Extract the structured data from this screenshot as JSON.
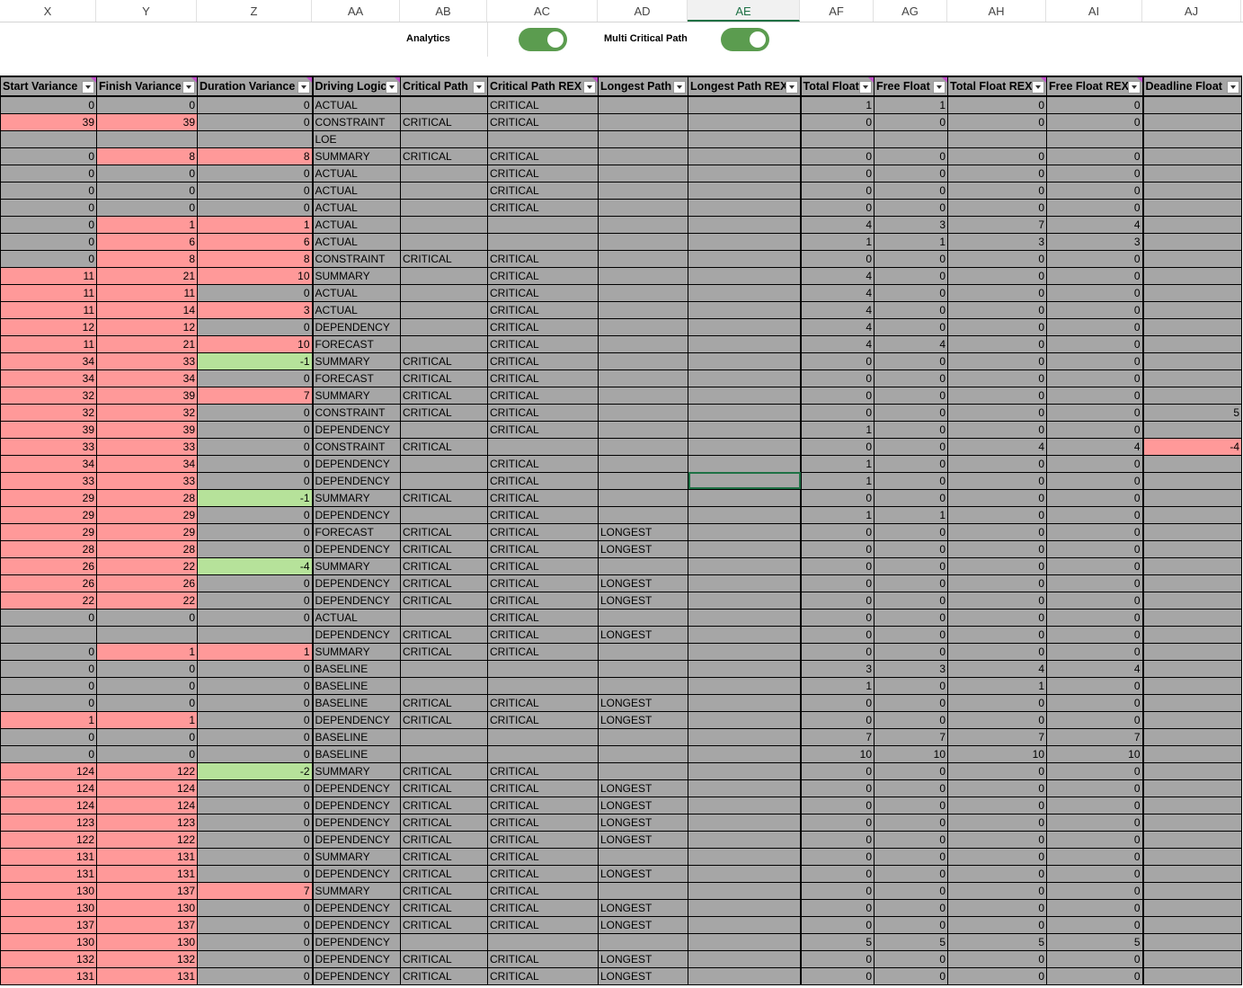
{
  "column_letters": [
    "X",
    "Y",
    "Z",
    "AA",
    "AB",
    "AC",
    "AD",
    "AE",
    "AF",
    "AG",
    "AH",
    "AI",
    "AJ"
  ],
  "selected_column": "AE",
  "toggles": [
    {
      "label": "Analytics",
      "on": true
    },
    {
      "label": "Multi Critical Path",
      "on": true
    }
  ],
  "colors": {
    "red": "#ff9999",
    "green": "#b6e29a",
    "gray": "#a6a6a6",
    "toggle": "#5b9c4f",
    "selection": "#1e7145"
  },
  "headers": [
    "Start Variance",
    "Finish Variance",
    "Duration Variance",
    "Driving Logic",
    "Critical Path",
    "Critical Path REX",
    "Longest Path",
    "Longest Path REX",
    "Total Float",
    "Free Float",
    "Total Float REX",
    "Free Float REX",
    "Deadline Float"
  ],
  "rows": [
    [
      "0",
      "0",
      "0",
      "ACTUAL",
      "",
      "CRITICAL",
      "",
      "",
      "1",
      "1",
      "0",
      "0",
      ""
    ],
    [
      "39",
      "39",
      "0",
      "CONSTRAINT",
      "CRITICAL",
      "CRITICAL",
      "",
      "",
      "0",
      "0",
      "0",
      "0",
      ""
    ],
    [
      "",
      "",
      "",
      "LOE",
      "",
      "",
      "",
      "",
      "",
      "",
      "",
      "",
      ""
    ],
    [
      "0",
      "8",
      "8",
      "SUMMARY",
      "CRITICAL",
      "CRITICAL",
      "",
      "",
      "0",
      "0",
      "0",
      "0",
      ""
    ],
    [
      "0",
      "0",
      "0",
      "ACTUAL",
      "",
      "CRITICAL",
      "",
      "",
      "0",
      "0",
      "0",
      "0",
      ""
    ],
    [
      "0",
      "0",
      "0",
      "ACTUAL",
      "",
      "CRITICAL",
      "",
      "",
      "0",
      "0",
      "0",
      "0",
      ""
    ],
    [
      "0",
      "0",
      "0",
      "ACTUAL",
      "",
      "CRITICAL",
      "",
      "",
      "0",
      "0",
      "0",
      "0",
      ""
    ],
    [
      "0",
      "1",
      "1",
      "ACTUAL",
      "",
      "",
      "",
      "",
      "4",
      "3",
      "7",
      "4",
      ""
    ],
    [
      "0",
      "6",
      "6",
      "ACTUAL",
      "",
      "",
      "",
      "",
      "1",
      "1",
      "3",
      "3",
      ""
    ],
    [
      "0",
      "8",
      "8",
      "CONSTRAINT",
      "CRITICAL",
      "CRITICAL",
      "",
      "",
      "0",
      "0",
      "0",
      "0",
      ""
    ],
    [
      "11",
      "21",
      "10",
      "SUMMARY",
      "",
      "CRITICAL",
      "",
      "",
      "4",
      "0",
      "0",
      "0",
      ""
    ],
    [
      "11",
      "11",
      "0",
      "ACTUAL",
      "",
      "CRITICAL",
      "",
      "",
      "4",
      "0",
      "0",
      "0",
      ""
    ],
    [
      "11",
      "14",
      "3",
      "ACTUAL",
      "",
      "CRITICAL",
      "",
      "",
      "4",
      "0",
      "0",
      "0",
      ""
    ],
    [
      "12",
      "12",
      "0",
      "DEPENDENCY",
      "",
      "CRITICAL",
      "",
      "",
      "4",
      "0",
      "0",
      "0",
      ""
    ],
    [
      "11",
      "21",
      "10",
      "FORECAST",
      "",
      "CRITICAL",
      "",
      "",
      "4",
      "4",
      "0",
      "0",
      ""
    ],
    [
      "34",
      "33",
      "-1",
      "SUMMARY",
      "CRITICAL",
      "CRITICAL",
      "",
      "",
      "0",
      "0",
      "0",
      "0",
      ""
    ],
    [
      "34",
      "34",
      "0",
      "FORECAST",
      "CRITICAL",
      "CRITICAL",
      "",
      "",
      "0",
      "0",
      "0",
      "0",
      ""
    ],
    [
      "32",
      "39",
      "7",
      "SUMMARY",
      "CRITICAL",
      "CRITICAL",
      "",
      "",
      "0",
      "0",
      "0",
      "0",
      ""
    ],
    [
      "32",
      "32",
      "0",
      "CONSTRAINT",
      "CRITICAL",
      "CRITICAL",
      "",
      "",
      "0",
      "0",
      "0",
      "0",
      "5"
    ],
    [
      "39",
      "39",
      "0",
      "DEPENDENCY",
      "",
      "CRITICAL",
      "",
      "",
      "1",
      "0",
      "0",
      "0",
      ""
    ],
    [
      "33",
      "33",
      "0",
      "CONSTRAINT",
      "CRITICAL",
      "",
      "",
      "",
      "0",
      "0",
      "4",
      "4",
      "-4"
    ],
    [
      "34",
      "34",
      "0",
      "DEPENDENCY",
      "",
      "CRITICAL",
      "",
      "",
      "1",
      "0",
      "0",
      "0",
      ""
    ],
    [
      "33",
      "33",
      "0",
      "DEPENDENCY",
      "",
      "CRITICAL",
      "",
      "",
      "1",
      "0",
      "0",
      "0",
      ""
    ],
    [
      "29",
      "28",
      "-1",
      "SUMMARY",
      "CRITICAL",
      "CRITICAL",
      "",
      "",
      "0",
      "0",
      "0",
      "0",
      ""
    ],
    [
      "29",
      "29",
      "0",
      "DEPENDENCY",
      "",
      "CRITICAL",
      "",
      "",
      "1",
      "1",
      "0",
      "0",
      ""
    ],
    [
      "29",
      "29",
      "0",
      "FORECAST",
      "CRITICAL",
      "CRITICAL",
      "LONGEST",
      "",
      "0",
      "0",
      "0",
      "0",
      ""
    ],
    [
      "28",
      "28",
      "0",
      "DEPENDENCY",
      "CRITICAL",
      "CRITICAL",
      "LONGEST",
      "",
      "0",
      "0",
      "0",
      "0",
      ""
    ],
    [
      "26",
      "22",
      "-4",
      "SUMMARY",
      "CRITICAL",
      "CRITICAL",
      "",
      "",
      "0",
      "0",
      "0",
      "0",
      ""
    ],
    [
      "26",
      "26",
      "0",
      "DEPENDENCY",
      "CRITICAL",
      "CRITICAL",
      "LONGEST",
      "",
      "0",
      "0",
      "0",
      "0",
      ""
    ],
    [
      "22",
      "22",
      "0",
      "DEPENDENCY",
      "CRITICAL",
      "CRITICAL",
      "LONGEST",
      "",
      "0",
      "0",
      "0",
      "0",
      ""
    ],
    [
      "0",
      "0",
      "0",
      "ACTUAL",
      "",
      "CRITICAL",
      "",
      "",
      "0",
      "0",
      "0",
      "0",
      ""
    ],
    [
      "",
      "",
      "",
      "DEPENDENCY",
      "CRITICAL",
      "CRITICAL",
      "LONGEST",
      "",
      "0",
      "0",
      "0",
      "0",
      ""
    ],
    [
      "0",
      "1",
      "1",
      "SUMMARY",
      "CRITICAL",
      "CRITICAL",
      "",
      "",
      "0",
      "0",
      "0",
      "0",
      ""
    ],
    [
      "0",
      "0",
      "0",
      "BASELINE",
      "",
      "",
      "",
      "",
      "3",
      "3",
      "4",
      "4",
      ""
    ],
    [
      "0",
      "0",
      "0",
      "BASELINE",
      "",
      "",
      "",
      "",
      "1",
      "0",
      "1",
      "0",
      ""
    ],
    [
      "0",
      "0",
      "0",
      "BASELINE",
      "CRITICAL",
      "CRITICAL",
      "LONGEST",
      "",
      "0",
      "0",
      "0",
      "0",
      ""
    ],
    [
      "1",
      "1",
      "0",
      "DEPENDENCY",
      "CRITICAL",
      "CRITICAL",
      "LONGEST",
      "",
      "0",
      "0",
      "0",
      "0",
      ""
    ],
    [
      "0",
      "0",
      "0",
      "BASELINE",
      "",
      "",
      "",
      "",
      "7",
      "7",
      "7",
      "7",
      ""
    ],
    [
      "0",
      "0",
      "0",
      "BASELINE",
      "",
      "",
      "",
      "",
      "10",
      "10",
      "10",
      "10",
      ""
    ],
    [
      "124",
      "122",
      "-2",
      "SUMMARY",
      "CRITICAL",
      "CRITICAL",
      "",
      "",
      "0",
      "0",
      "0",
      "0",
      ""
    ],
    [
      "124",
      "124",
      "0",
      "DEPENDENCY",
      "CRITICAL",
      "CRITICAL",
      "LONGEST",
      "",
      "0",
      "0",
      "0",
      "0",
      ""
    ],
    [
      "124",
      "124",
      "0",
      "DEPENDENCY",
      "CRITICAL",
      "CRITICAL",
      "LONGEST",
      "",
      "0",
      "0",
      "0",
      "0",
      ""
    ],
    [
      "123",
      "123",
      "0",
      "DEPENDENCY",
      "CRITICAL",
      "CRITICAL",
      "LONGEST",
      "",
      "0",
      "0",
      "0",
      "0",
      ""
    ],
    [
      "122",
      "122",
      "0",
      "DEPENDENCY",
      "CRITICAL",
      "CRITICAL",
      "LONGEST",
      "",
      "0",
      "0",
      "0",
      "0",
      ""
    ],
    [
      "131",
      "131",
      "0",
      "SUMMARY",
      "CRITICAL",
      "CRITICAL",
      "",
      "",
      "0",
      "0",
      "0",
      "0",
      ""
    ],
    [
      "131",
      "131",
      "0",
      "DEPENDENCY",
      "CRITICAL",
      "CRITICAL",
      "LONGEST",
      "",
      "0",
      "0",
      "0",
      "0",
      ""
    ],
    [
      "130",
      "137",
      "7",
      "SUMMARY",
      "CRITICAL",
      "CRITICAL",
      "",
      "",
      "0",
      "0",
      "0",
      "0",
      ""
    ],
    [
      "130",
      "130",
      "0",
      "DEPENDENCY",
      "CRITICAL",
      "CRITICAL",
      "LONGEST",
      "",
      "0",
      "0",
      "0",
      "0",
      ""
    ],
    [
      "137",
      "137",
      "0",
      "DEPENDENCY",
      "CRITICAL",
      "CRITICAL",
      "LONGEST",
      "",
      "0",
      "0",
      "0",
      "0",
      ""
    ],
    [
      "130",
      "130",
      "0",
      "DEPENDENCY",
      "",
      "",
      "",
      "",
      "5",
      "5",
      "5",
      "5",
      ""
    ],
    [
      "132",
      "132",
      "0",
      "DEPENDENCY",
      "CRITICAL",
      "CRITICAL",
      "LONGEST",
      "",
      "0",
      "0",
      "0",
      "0",
      ""
    ],
    [
      "131",
      "131",
      "0",
      "DEPENDENCY",
      "CRITICAL",
      "CRITICAL",
      "LONGEST",
      "",
      "0",
      "0",
      "0",
      "0",
      ""
    ]
  ]
}
